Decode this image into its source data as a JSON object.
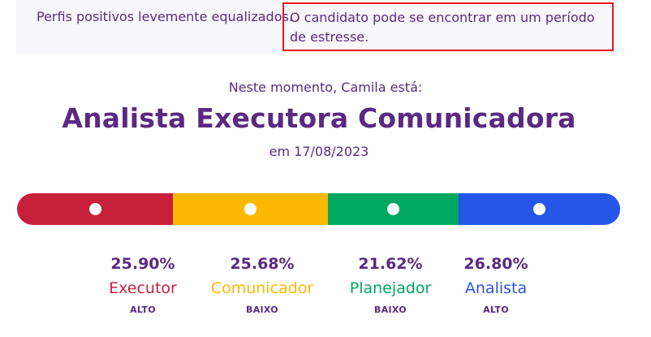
{
  "banner": {
    "left_text": "Perfis positivos levemente equalizados.",
    "highlight_text": "O candidato pode se encontrar em um período de estresse.",
    "highlight_color": "#e41b1b"
  },
  "profile": {
    "subtitle": "Neste momento, Camila está:",
    "headline": "Analista Executora Comunicadora",
    "date": "em 17/08/2023"
  },
  "bar": {
    "segments": [
      {
        "name": "Executor",
        "color": "#c8203a",
        "share": 0.259,
        "marker": 0.5
      },
      {
        "name": "Comunicador",
        "color": "#ffb800",
        "share": 0.2568,
        "marker": 0.5
      },
      {
        "name": "Planejador",
        "color": "#00a862",
        "share": 0.2162,
        "marker": 0.5
      },
      {
        "name": "Analista",
        "color": "#2656e8",
        "share": 0.268,
        "marker": 0.5
      }
    ]
  },
  "stats": [
    {
      "pct": "25.90%",
      "label": "Executor",
      "level": "ALTO",
      "color": "#c8203a"
    },
    {
      "pct": "25.68%",
      "label": "Comunicador",
      "level": "BAIXO",
      "color": "#ffb800"
    },
    {
      "pct": "21.62%",
      "label": "Planejador",
      "level": "BAIXO",
      "color": "#00a862"
    },
    {
      "pct": "26.80%",
      "label": "Analista",
      "level": "ALTO",
      "color": "#2656e8"
    }
  ]
}
